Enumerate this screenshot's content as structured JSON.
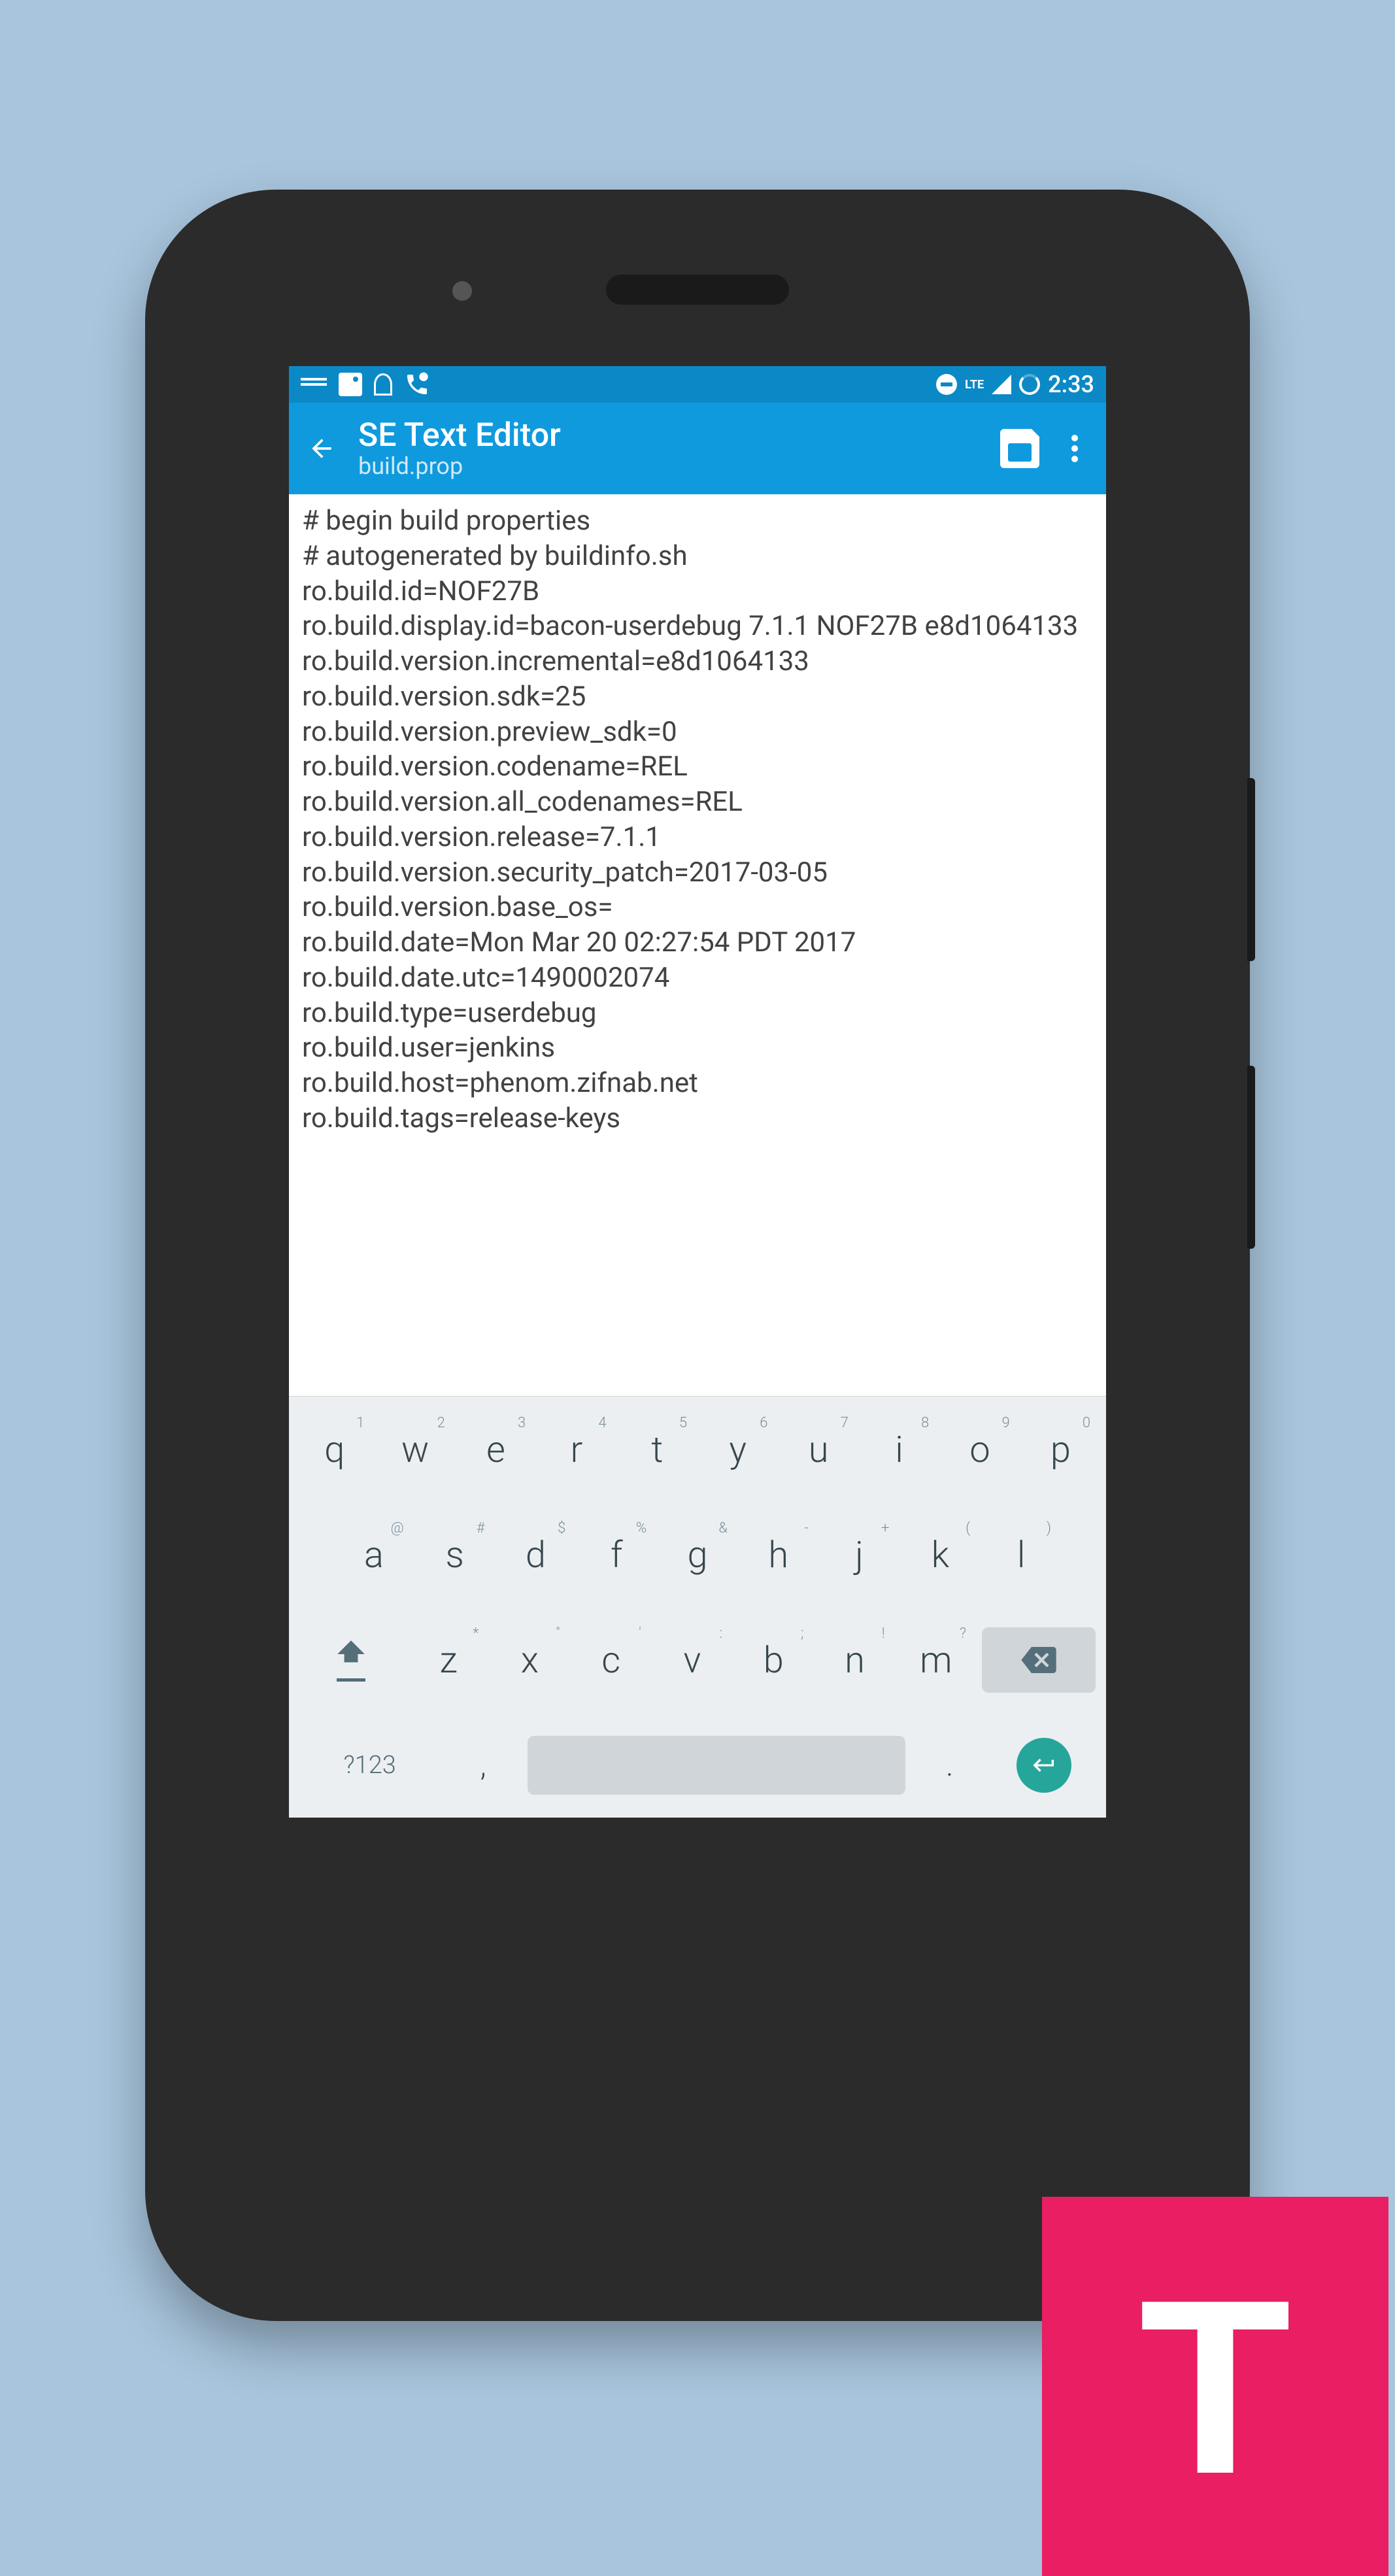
{
  "status_bar": {
    "time": "2:33",
    "lte": "LTE"
  },
  "app_bar": {
    "title": "SE Text Editor",
    "subtitle": "build.prop"
  },
  "editor_content": "# begin build properties\n# autogenerated by buildinfo.sh\nro.build.id=NOF27B\nro.build.display.id=bacon-userdebug 7.1.1 NOF27B e8d1064133\nro.build.version.incremental=e8d1064133\nro.build.version.sdk=25\nro.build.version.preview_sdk=0\nro.build.version.codename=REL\nro.build.version.all_codenames=REL\nro.build.version.release=7.1.1\nro.build.version.security_patch=2017-03-05\nro.build.version.base_os=\nro.build.date=Mon Mar 20 02:27:54 PDT 2017\nro.build.date.utc=1490002074\nro.build.type=userdebug\nro.build.user=jenkins\nro.build.host=phenom.zifnab.net\nro.build.tags=release-keys",
  "keyboard": {
    "row1": [
      {
        "main": "q",
        "hint": "1"
      },
      {
        "main": "w",
        "hint": "2"
      },
      {
        "main": "e",
        "hint": "3"
      },
      {
        "main": "r",
        "hint": "4"
      },
      {
        "main": "t",
        "hint": "5"
      },
      {
        "main": "y",
        "hint": "6"
      },
      {
        "main": "u",
        "hint": "7"
      },
      {
        "main": "i",
        "hint": "8"
      },
      {
        "main": "o",
        "hint": "9"
      },
      {
        "main": "p",
        "hint": "0"
      }
    ],
    "row2": [
      {
        "main": "a",
        "hint": "@"
      },
      {
        "main": "s",
        "hint": "#"
      },
      {
        "main": "d",
        "hint": "$"
      },
      {
        "main": "f",
        "hint": "%"
      },
      {
        "main": "g",
        "hint": "&"
      },
      {
        "main": "h",
        "hint": "-"
      },
      {
        "main": "j",
        "hint": "+"
      },
      {
        "main": "k",
        "hint": "("
      },
      {
        "main": "l",
        "hint": ")"
      }
    ],
    "row3": [
      {
        "main": "z",
        "hint": "*"
      },
      {
        "main": "x",
        "hint": "\""
      },
      {
        "main": "c",
        "hint": "'"
      },
      {
        "main": "v",
        "hint": ":"
      },
      {
        "main": "b",
        "hint": ";"
      },
      {
        "main": "n",
        "hint": "!"
      },
      {
        "main": "m",
        "hint": "?"
      }
    ],
    "mode": "?123",
    "comma": ",",
    "period": "."
  },
  "watermark": {
    "letter": "T"
  }
}
